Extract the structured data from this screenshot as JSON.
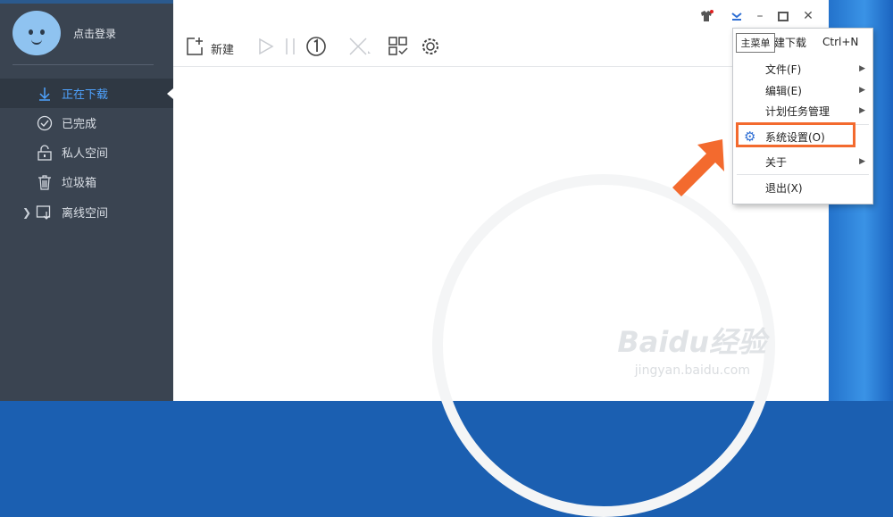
{
  "sidebar": {
    "login_text": "点击登录",
    "items": [
      {
        "label": "正在下载",
        "icon": "download-arrow-icon",
        "active": true
      },
      {
        "label": "已完成",
        "icon": "check-circle-icon"
      },
      {
        "label": "私人空间",
        "icon": "lock-icon"
      },
      {
        "label": "垃圾箱",
        "icon": "trash-icon"
      },
      {
        "label": "离线空间",
        "icon": "cloud-download-icon",
        "expandable": true
      }
    ]
  },
  "toolbar": {
    "new_label": "新建"
  },
  "main_menu": {
    "tooltip": "主菜单",
    "items": [
      {
        "label": "建下载",
        "shortcut": "Ctrl+N"
      },
      {
        "label": "文件(F)",
        "submenu": true
      },
      {
        "label": "编辑(E)",
        "submenu": true
      },
      {
        "label": "计划任务管理",
        "submenu": true
      },
      {
        "label": "系统设置(O)",
        "icon": "gear-icon"
      },
      {
        "label": "关于",
        "submenu": true
      },
      {
        "label": "退出(X)"
      }
    ]
  },
  "watermark": {
    "logo": "Baidu经验",
    "url": "jingyan.baidu.com"
  },
  "colors": {
    "sidebar_bg": "#3a4451",
    "accent": "#4fa3ff",
    "highlight": "#f36a2e"
  }
}
